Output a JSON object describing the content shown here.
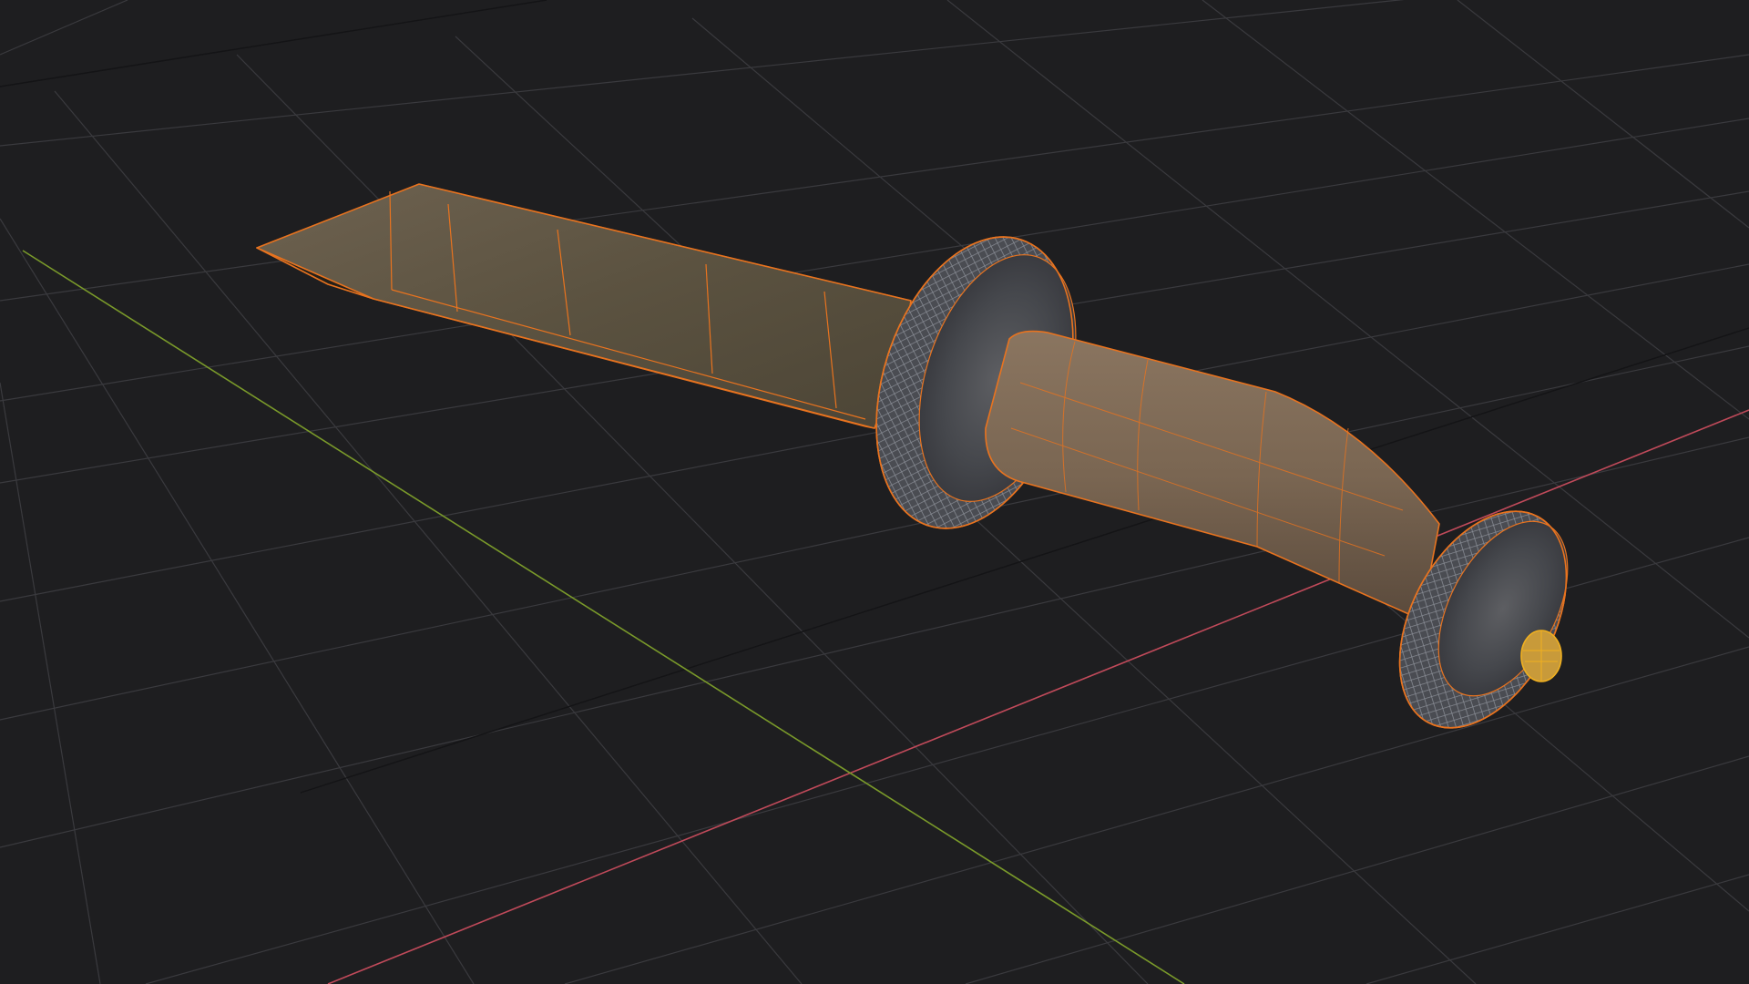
{
  "viewport": {
    "mode": "3d-viewport",
    "background_color": "#1e1e20",
    "grid_color": "#3a3a3e",
    "axis_x_color": "#c04a5a",
    "axis_y_color": "#7a9a2a",
    "selection_outline_color": "#e8731f",
    "active_object_color": "#f0b020"
  },
  "scene": {
    "object": "knife",
    "parts": [
      {
        "name": "blade",
        "shading": "textured"
      },
      {
        "name": "guard",
        "shading": "textured"
      },
      {
        "name": "handle",
        "shading": "textured"
      },
      {
        "name": "pommel",
        "shading": "textured"
      },
      {
        "name": "end-cap",
        "shading": "wireframe-selected"
      }
    ],
    "wireframe_overlay": true
  }
}
